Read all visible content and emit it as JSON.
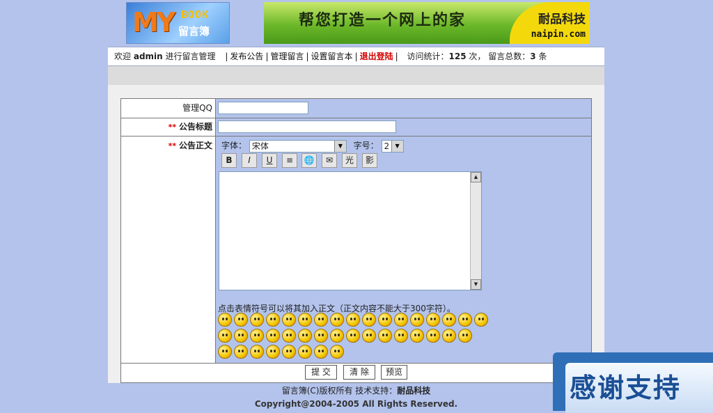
{
  "header": {
    "logo": {
      "my": "MY",
      "book": "BOOK",
      "guestbook": "留言簿"
    },
    "banner": {
      "slogan": "帮您打造一个网上的家",
      "brand": "耐品科技",
      "url": "naipin.com"
    }
  },
  "nav": {
    "welcome_prefix": "欢迎",
    "user": "admin",
    "welcome_suffix": "进行留言管理",
    "links": [
      "发布公告",
      "管理留言",
      "设置留言本"
    ],
    "logout": "退出登陆",
    "stats_label": "访问统计：",
    "visits": "125",
    "visits_unit": "次，",
    "count_label": "留言总数：",
    "count": "3",
    "count_unit": "条"
  },
  "form": {
    "qq_label": "管理QQ",
    "title_req": "**",
    "title_label": "公告标题",
    "body_req": "**",
    "body_label": "公告正文",
    "font_label": "字体：",
    "font_value": "宋体",
    "size_label": "字号：",
    "size_value": "2",
    "format_buttons": [
      "B",
      "I",
      "U",
      "≡",
      "🌐",
      "✉",
      "光",
      "影"
    ],
    "hint": "点击表情符号可以将其加入正文（正文内容不能大于300字符）。",
    "submit": "提 交",
    "clear": "清 除",
    "preview": "预览"
  },
  "footer": {
    "line1_prefix": "留言簿(C)版权所有  技术支持：",
    "line1_brand": "耐品科技",
    "line2": "Copyright@2004-2005 All Rights Reserved."
  },
  "thanks": "感谢支持",
  "colors": {
    "page_bg": "#b3c3ec",
    "logout": "#d40000",
    "thanks_bg": "#2f6fb7"
  }
}
